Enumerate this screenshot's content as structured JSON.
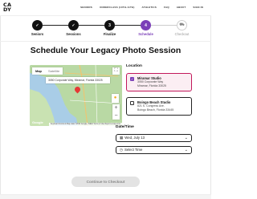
{
  "brand": {
    "logo_text": "CA\nDY"
  },
  "nav": {
    "items": [
      "SENIORS",
      "UNDERCLASS (10TH-11TH)",
      "ATHLETICS",
      "FAQ",
      "ABOUT",
      "SIGN IN"
    ]
  },
  "stepper": {
    "steps": [
      {
        "number": "",
        "label": "Seniors",
        "state": "done"
      },
      {
        "number": "",
        "label": "Sessions",
        "state": "done"
      },
      {
        "number": "3",
        "label": "Finalize",
        "state": "done"
      },
      {
        "number": "4",
        "label": "Schedule",
        "state": "active"
      },
      {
        "number": "",
        "label": "Checkout",
        "state": "todo"
      }
    ]
  },
  "page": {
    "title": "Schedule Your Legacy Photo Session"
  },
  "map": {
    "tab_map": "Map",
    "tab_satellite": "Satellite",
    "popup_text": "3050 Corporate Way, Miramar, Florida 33025",
    "google_label": "Google",
    "credits": "Keyboard shortcuts  Map data ©2022 Google, INEGI  Terms of Use  Report a map error"
  },
  "location": {
    "label": "Location",
    "options": [
      {
        "name": "Miramar Studio",
        "line1": "3050 Corporate Way",
        "line2": "Miramar, Florida 33025",
        "selected": true
      },
      {
        "name": "Boingo Beach Studio",
        "line1": "821 S. Congress Ave.",
        "line2": "Boingo Beach, Florida 33445",
        "selected": false
      }
    ]
  },
  "datetime": {
    "label": "Date/Time",
    "date_value": "Wed, July 13",
    "time_placeholder": "Select Time"
  },
  "cta": {
    "label": "Continue to Checkout"
  },
  "colors": {
    "accent": "#7b3fb8",
    "selected_border": "#c2185b",
    "selected_bg": "#fbeef3"
  }
}
